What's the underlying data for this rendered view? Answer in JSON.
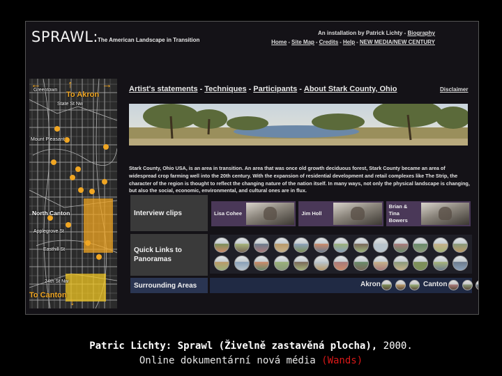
{
  "site": {
    "logo": "SPRAWL:",
    "tagline": "The American Landscape in Transition",
    "credit_prefix": "An installation by Patrick Lichty - ",
    "credit_link": "Biography",
    "top_links": [
      "Home",
      "Site Map",
      "Credits",
      "Help",
      "NEW MEDIA/NEW CENTURY"
    ]
  },
  "nav": {
    "items": [
      "Artist's statements",
      "Techniques",
      "Participants",
      "About Stark County, Ohio"
    ],
    "disclaimer": "Disclaimer"
  },
  "map": {
    "to_akron": "To Akron",
    "to_canton": "To Canton",
    "labels": [
      "Greentown",
      "State St Nw",
      "Mount Pleasant",
      "North Canton",
      "Applegrove St",
      "Easthill St",
      "24th St Nw"
    ],
    "arrow_up": "↑",
    "arrow_left": "←",
    "arrow_right": "→",
    "arrow_down": "↓",
    "accent_color": "#f0a623"
  },
  "description": "Stark County, Ohio USA, is an area in transition. An area that was once old growth deciduous forest, Stark County became an area of widespread crop farming well into the 20th century. With the expansion of residential development and retail complexes like The Strip, the character of the region is thought to reflect the changing nature of the nation itself. In many ways, not only the physical landscape is changing, but also the social, economic, environmental, and cultural ones are in flux.",
  "sections": {
    "interview": "Interview clips",
    "quick_links": "Quick Links to Panoramas",
    "surrounding": "Surrounding Areas"
  },
  "clips": [
    {
      "name": "Lisa Cohee"
    },
    {
      "name": "Jim Holl"
    },
    {
      "name": "Brian & Tina Bowers"
    }
  ],
  "surrounding": {
    "left": "Akron",
    "right": "Canton"
  },
  "caption": {
    "bold": "Patric Lichty: Sprawl (Živelně zastavěná plocha),",
    "year": " 2000.",
    "line2": "Online dokumentární nová média ",
    "red": "(Wands)"
  }
}
